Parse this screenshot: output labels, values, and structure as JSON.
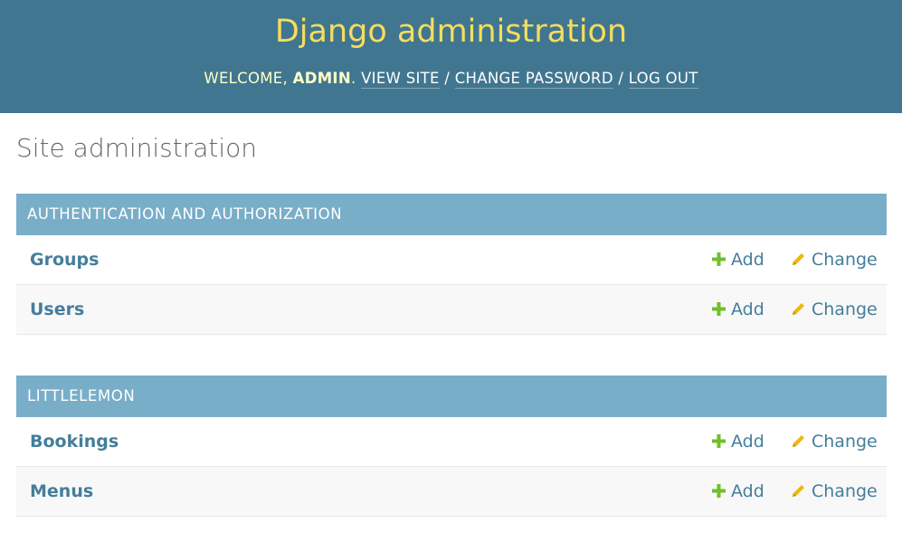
{
  "header": {
    "brand": "Django administration",
    "welcome_prefix": "WELCOME, ",
    "username": "ADMIN",
    "welcome_suffix": ". ",
    "view_site": "VIEW SITE",
    "separator": " / ",
    "change_password": "CHANGE PASSWORD",
    "log_out": "LOG OUT"
  },
  "page": {
    "title": "Site administration"
  },
  "modules": [
    {
      "caption": "AUTHENTICATION AND AUTHORIZATION",
      "rows": [
        {
          "name": "Groups",
          "add": "Add",
          "change": "Change"
        },
        {
          "name": "Users",
          "add": "Add",
          "change": "Change"
        }
      ]
    },
    {
      "caption": "LITTLELEMON",
      "rows": [
        {
          "name": "Bookings",
          "add": "Add",
          "change": "Change"
        },
        {
          "name": "Menus",
          "add": "Add",
          "change": "Change"
        }
      ]
    }
  ],
  "icons": {
    "add": "plus-icon",
    "change": "pencil-icon"
  },
  "colors": {
    "header_bg": "#417690",
    "brand": "#f5dd5d",
    "caption_bg": "#79aec8",
    "link": "#447e9b",
    "add_icon": "#70bf2b",
    "change_icon": "#efb80b"
  }
}
